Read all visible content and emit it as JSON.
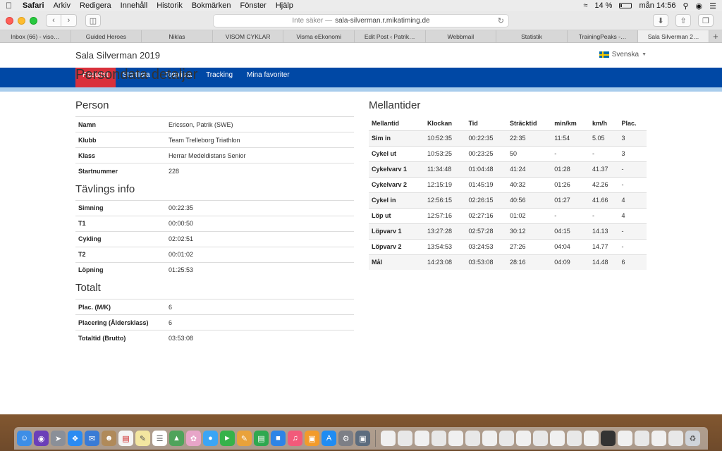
{
  "menubar": {
    "app": "Safari",
    "items": [
      "Arkiv",
      "Redigera",
      "Innehåll",
      "Historik",
      "Bokmärken",
      "Fönster",
      "Hjälp"
    ],
    "battery": "14 %",
    "clock": "mån 14:56"
  },
  "toolbar": {
    "address_prefix": "Inte säker —",
    "address_host": "sala-silverman.r.mikatiming.de"
  },
  "tabs": [
    "Inbox (66) - viso…",
    "Guided Heroes",
    "Niklas",
    "VISOM CYKLAR",
    "Visma eEkonomi",
    "Edit Post ‹ Patrik…",
    "Webbmail",
    "Statistik",
    "TrainingPeaks -…",
    "Sala Silverman 2…"
  ],
  "site": {
    "title": "Sala Silverman 2019",
    "language": "Svenska",
    "nav": [
      "Resultat",
      "Startlista",
      "Topplista",
      "Tracking",
      "Mina favoriter"
    ]
  },
  "page_title": "Persondata detaljer",
  "person": {
    "heading": "Person",
    "rows": [
      {
        "label": "Namn",
        "value": "Ericsson, Patrik (SWE)"
      },
      {
        "label": "Klubb",
        "value": "Team Trelleborg Triathlon"
      },
      {
        "label": "Klass",
        "value": "Herrar Medeldistans Senior"
      },
      {
        "label": "Startnummer",
        "value": "228"
      }
    ]
  },
  "race_info": {
    "heading": "Tävlings info",
    "rows": [
      {
        "label": "Simning",
        "value": "00:22:35"
      },
      {
        "label": "T1",
        "value": "00:00:50"
      },
      {
        "label": "Cykling",
        "value": "02:02:51"
      },
      {
        "label": "T2",
        "value": "00:01:02"
      },
      {
        "label": "Löpning",
        "value": "01:25:53"
      }
    ]
  },
  "total": {
    "heading": "Totalt",
    "rows": [
      {
        "label": "Plac. (M/K)",
        "value": "6"
      },
      {
        "label": "Placering (Åldersklass)",
        "value": "6"
      },
      {
        "label": "Totaltid (Brutto)",
        "value": "03:53:08"
      }
    ]
  },
  "splits": {
    "heading": "Mellantider",
    "columns": [
      "Mellantid",
      "Klockan",
      "Tid",
      "Sträcktid",
      "min/km",
      "km/h",
      "Plac."
    ],
    "rows": [
      [
        "Sim in",
        "10:52:35",
        "00:22:35",
        "22:35",
        "11:54",
        "5.05",
        "3"
      ],
      [
        "Cykel ut",
        "10:53:25",
        "00:23:25",
        "50",
        "-",
        "-",
        "3"
      ],
      [
        "Cykelvarv 1",
        "11:34:48",
        "01:04:48",
        "41:24",
        "01:28",
        "41.37",
        "-"
      ],
      [
        "Cykelvarv 2",
        "12:15:19",
        "01:45:19",
        "40:32",
        "01:26",
        "42.26",
        "-"
      ],
      [
        "Cykel in",
        "12:56:15",
        "02:26:15",
        "40:56",
        "01:27",
        "41.66",
        "4"
      ],
      [
        "Löp ut",
        "12:57:16",
        "02:27:16",
        "01:02",
        "-",
        "-",
        "4"
      ],
      [
        "Löpvarv 1",
        "13:27:28",
        "02:57:28",
        "30:12",
        "04:15",
        "14.13",
        "-"
      ],
      [
        "Löpvarv 2",
        "13:54:53",
        "03:24:53",
        "27:26",
        "04:04",
        "14.77",
        "-"
      ],
      [
        "Mål",
        "14:23:08",
        "03:53:08",
        "28:16",
        "04:09",
        "14.48",
        "6"
      ]
    ]
  },
  "colors": {
    "nav_blue": "#0048a5",
    "nav_active_red": "#d9303b",
    "subbar": "#a9cdec"
  }
}
